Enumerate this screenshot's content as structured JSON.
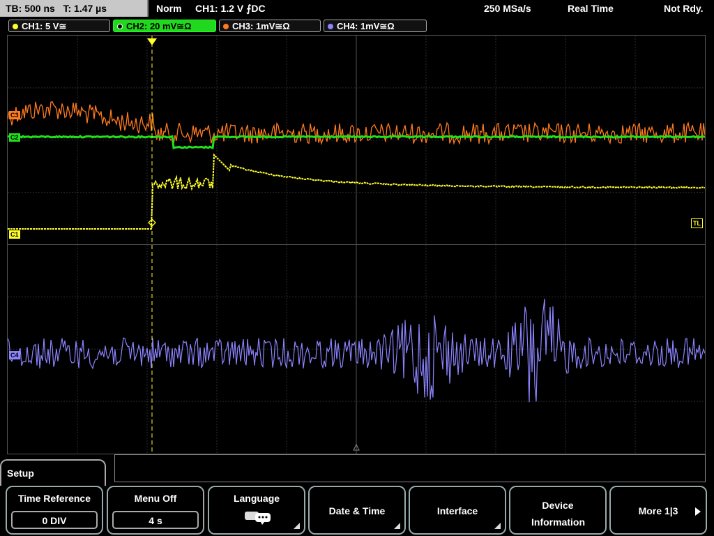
{
  "status": {
    "timebase": "TB: 500 ns",
    "trigger_time": "T: 1.47 µs",
    "mode": "Norm",
    "trigger_info": "CH1: 1.2 V ⨍DC",
    "sample_rate": "250 MSa/s",
    "acq_mode": "Real Time",
    "ready_state": "Not Rdy."
  },
  "channels": [
    {
      "label": "CH1: 5 V≅",
      "color": "#ffff2a",
      "active": false
    },
    {
      "label": "CH2: 20 mV≅Ω",
      "color": "#22e01c",
      "active": true
    },
    {
      "label": "CH3: 1mV≅Ω",
      "color": "#ff7a1e",
      "active": false
    },
    {
      "label": "CH4: 1mV≅Ω",
      "color": "#8c84ff",
      "active": false
    }
  ],
  "markers": {
    "trigger_level": "TL",
    "ch1_ground": "C1",
    "ch3": "C3",
    "ch2": "C2",
    "ch4": "C4"
  },
  "menu": {
    "title": "Setup",
    "softkeys": [
      {
        "label": "Time Reference",
        "value": "0 DIV"
      },
      {
        "label": "Menu Off",
        "value": "4 s"
      },
      {
        "label": "Language",
        "icon": "speech-bubble-icon"
      },
      {
        "label": "Date & Time"
      },
      {
        "label": "Interface"
      },
      {
        "label": "Device Information"
      },
      {
        "label": "More 1|3"
      }
    ]
  }
}
